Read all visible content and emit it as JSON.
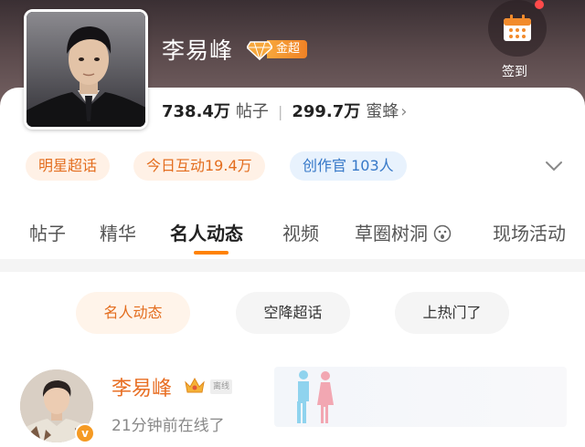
{
  "profile": {
    "name": "李易峰",
    "badge_label": "金超",
    "posts_count": "738.4万",
    "posts_label": "帖子",
    "fans_count": "299.7万",
    "fans_label": "蜜蜂",
    "checkin_label": "签到"
  },
  "tags": [
    {
      "label": "明星超话",
      "color": "orange"
    },
    {
      "label": "今日互动19.4万",
      "color": "orange"
    },
    {
      "label": "创作官 103人",
      "color": "blue"
    }
  ],
  "tabs": [
    {
      "label": "帖子",
      "active": false
    },
    {
      "label": "精华",
      "active": false
    },
    {
      "label": "名人动态",
      "active": true
    },
    {
      "label": "视频",
      "active": false
    },
    {
      "label": "草圈树洞",
      "active": false
    },
    {
      "label": "现场活动",
      "active": false
    }
  ],
  "filters": [
    {
      "label": "名人动态",
      "active": true
    },
    {
      "label": "空降超话",
      "active": false
    },
    {
      "label": "上热门了",
      "active": false
    }
  ],
  "post": {
    "author": "李易峰",
    "status_tag": "离线",
    "time_text": "21分钟前在线了"
  },
  "colors": {
    "accent": "#ff8200",
    "name_orange": "#e86f24",
    "tag_blue": "#3678c8"
  }
}
